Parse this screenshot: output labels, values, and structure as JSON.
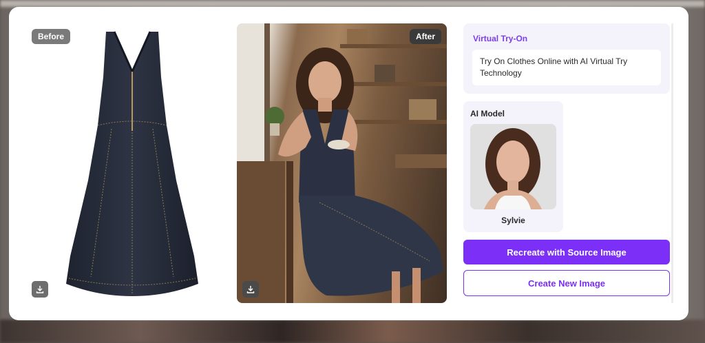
{
  "before": {
    "tag": "Before",
    "icons": {
      "download": "download-icon"
    }
  },
  "after": {
    "tag": "After",
    "icons": {
      "download": "download-icon"
    }
  },
  "info": {
    "title": "Virtual Try-On",
    "description": "Try On Clothes Online with AI Virtual Try Technology"
  },
  "model": {
    "title": "AI Model",
    "name": "Sylvie"
  },
  "actions": {
    "recreate_label": "Recreate with Source Image",
    "create_label": "Create New Image"
  },
  "colors": {
    "accent": "#7b2ff7",
    "accent_text": "#7b3fe4",
    "card_bg": "#f4f3fb",
    "denim": "#2a2f3e"
  }
}
